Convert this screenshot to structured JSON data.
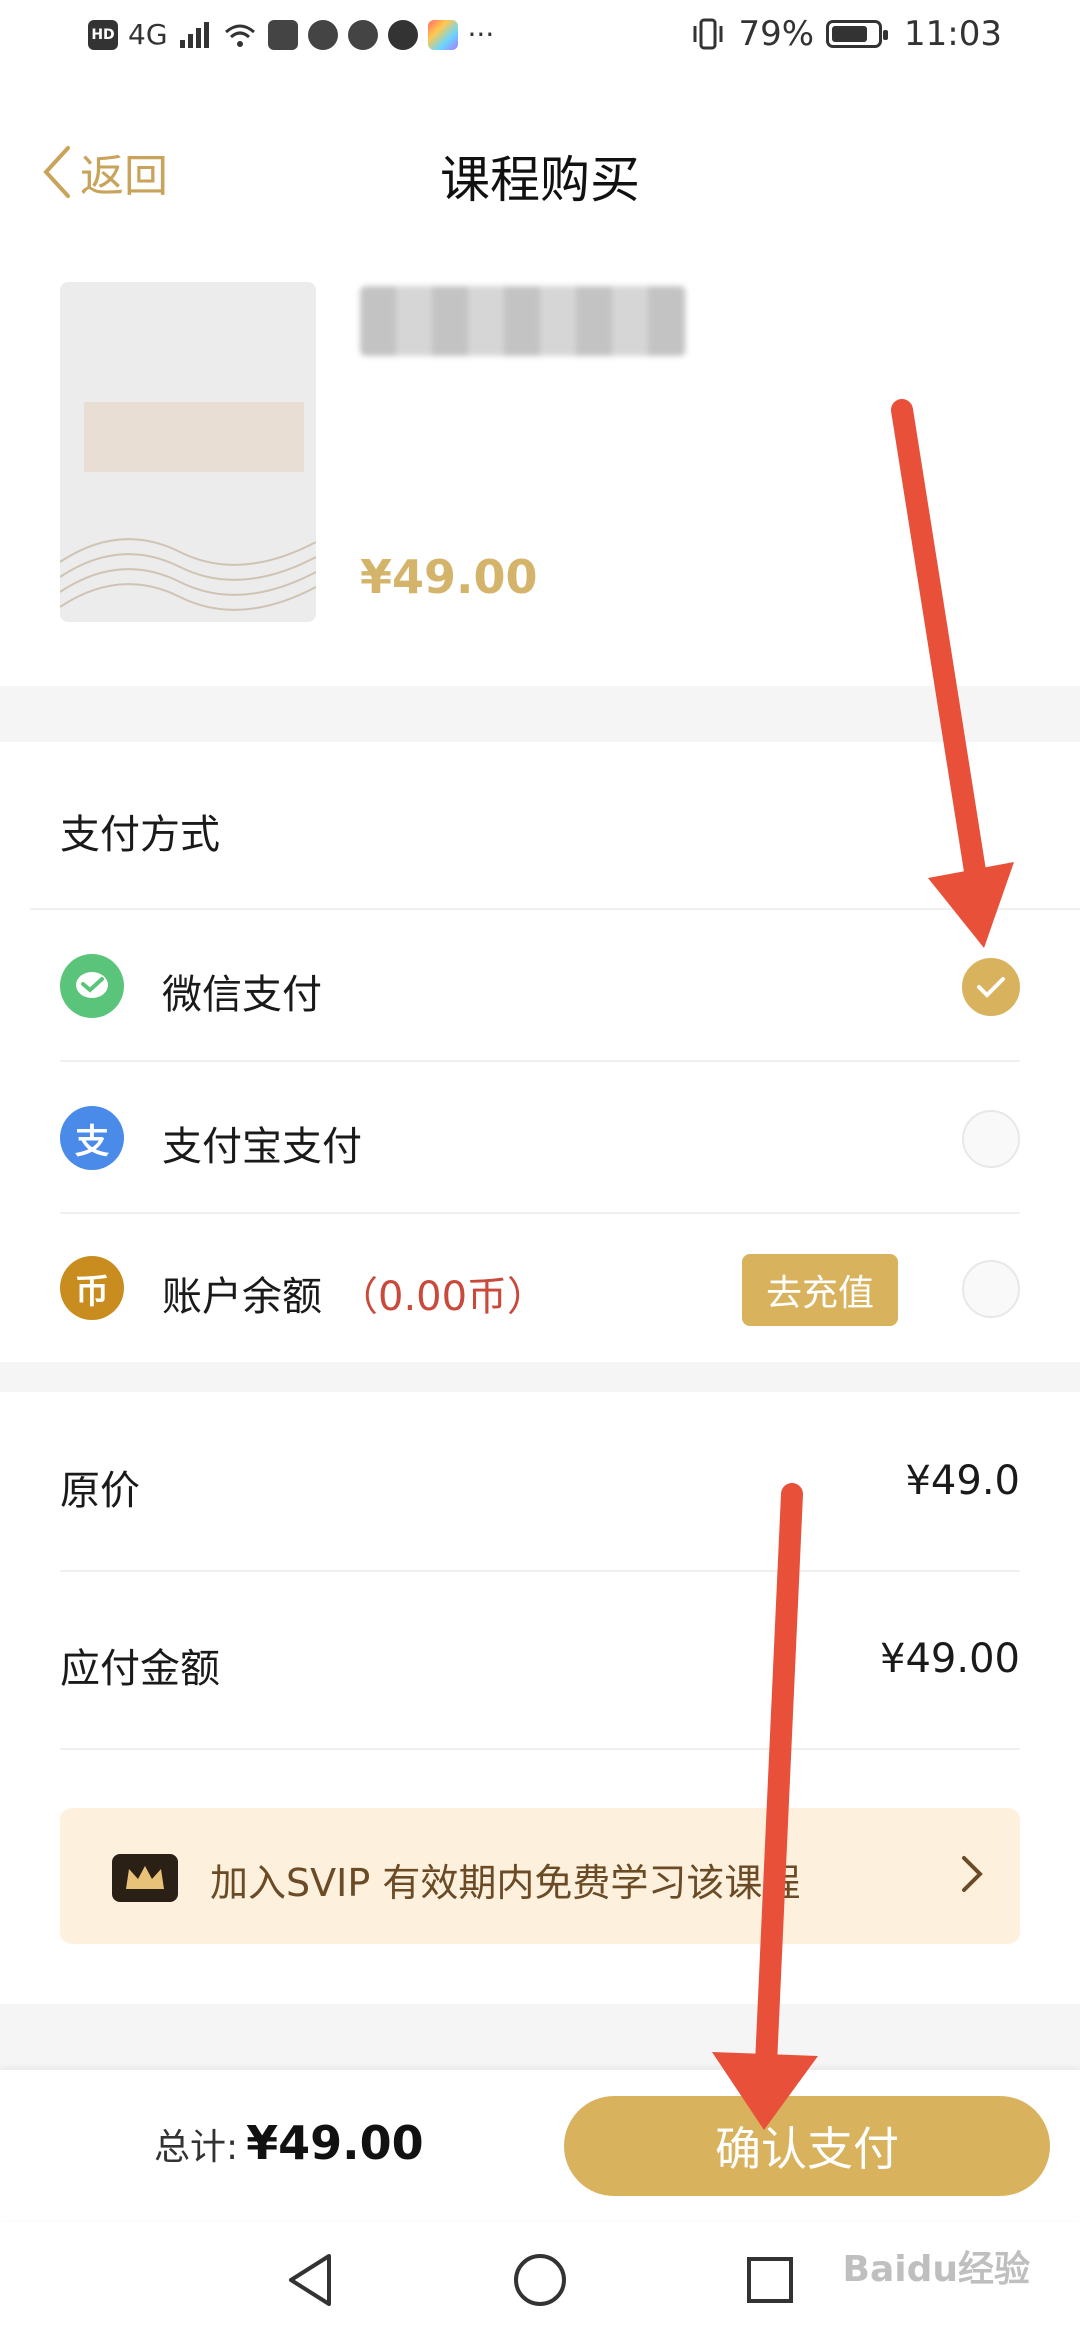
{
  "status_bar": {
    "left_icons": [
      "hd-icon",
      "signal-4g-icon",
      "wifi-icon",
      "huawei-icon",
      "hexagon-icon",
      "chat-icon",
      "qq-icon",
      "app-color-icon",
      "more-dots-icon"
    ],
    "hd": "HD",
    "network": "4G",
    "battery_percent": "79%",
    "battery_level": 0.79,
    "time": "11:03"
  },
  "header": {
    "back_label": "返回",
    "title": "课程购买"
  },
  "course": {
    "price": "¥49.00"
  },
  "payment": {
    "section_title": "支付方式",
    "methods": [
      {
        "icon": "wechat-pay-icon",
        "icon_glyph": "",
        "label": "微信支付",
        "extra": "",
        "selected": true,
        "color": "#5ac57a"
      },
      {
        "icon": "alipay-icon",
        "icon_glyph": "支",
        "label": "支付宝支付",
        "extra": "",
        "selected": false,
        "color": "#4a8bea"
      },
      {
        "icon": "coin-icon",
        "icon_glyph": "币",
        "label": "账户余额",
        "extra": "（0.00币）",
        "selected": false,
        "color": "#c98d1f"
      }
    ],
    "recharge_label": "去充值"
  },
  "pricing": {
    "original_label": "原价",
    "original_value": "¥49.0",
    "payable_label": "应付金额",
    "payable_value": "¥49.00"
  },
  "svip": {
    "text": "加入SVIP 有效期内免费学习该课程"
  },
  "bottom": {
    "total_label": "总计:",
    "total_value": "¥49.00",
    "confirm_label": "确认支付"
  },
  "colors": {
    "accent": "#d9b25e",
    "price_gold": "#d4b46a",
    "balance_red": "#c94a3a",
    "annotation_arrow": "#e8503a"
  },
  "watermark": "Baidu经验"
}
